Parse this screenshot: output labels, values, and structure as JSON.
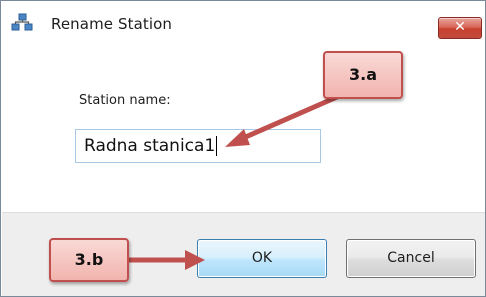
{
  "dialog": {
    "title": "Rename Station",
    "title_icon": "station-network-icon",
    "close_glyph": "✕"
  },
  "form": {
    "station_name_label": "Station name:",
    "station_name_value": "Radna stanica1"
  },
  "buttons": {
    "ok_label": "OK",
    "cancel_label": "Cancel"
  },
  "annotations": {
    "step_a_label": "3.a",
    "step_b_label": "3.b"
  },
  "colors": {
    "callout_fill": "#f2b4ae",
    "callout_border": "#c0504d",
    "arrow": "#c0504d",
    "ok_border": "#3c7fb1",
    "close_button": "#c7412f"
  }
}
